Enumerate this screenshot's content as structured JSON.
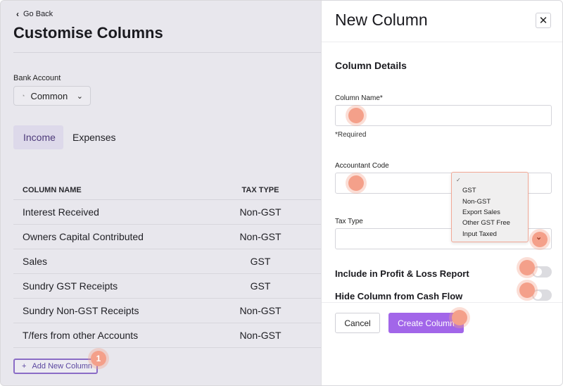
{
  "left": {
    "go_back": "Go Back",
    "title": "Customise Columns",
    "bank_account_label": "Bank Account",
    "bank_account_value": "Common",
    "tabs": [
      {
        "label": "Income",
        "active": true
      },
      {
        "label": "Expenses",
        "active": false
      }
    ],
    "table": {
      "headers": [
        "COLUMN NAME",
        "TAX TYPE"
      ],
      "rows": [
        {
          "name": "Interest Received",
          "tax": "Non-GST"
        },
        {
          "name": "Owners Capital Contributed",
          "tax": "Non-GST"
        },
        {
          "name": "Sales",
          "tax": "GST"
        },
        {
          "name": "Sundry GST Receipts",
          "tax": "GST"
        },
        {
          "name": "Sundry Non-GST Receipts",
          "tax": "Non-GST"
        },
        {
          "name": "T/fers from other Accounts",
          "tax": "Non-GST"
        }
      ]
    },
    "add_button": "Add New Column",
    "step_badge": "1"
  },
  "drawer": {
    "title": "New Column",
    "section": "Column Details",
    "column_name_label": "Column Name*",
    "required_text": "*Required",
    "accountant_code_label": "Accountant Code",
    "tax_type_label": "Tax Type",
    "tax_type_options": [
      "GST",
      "Non-GST",
      "Export Sales",
      "Other GST Free",
      "Input Taxed"
    ],
    "include_pl_label": "Include in Profit & Loss Report",
    "hide_cash_flow_label": "Hide Column from Cash Flow",
    "cancel_label": "Cancel",
    "create_label": "Create Column"
  },
  "colors": {
    "accent": "#a266e9",
    "hotspot": "#f4a08a"
  }
}
